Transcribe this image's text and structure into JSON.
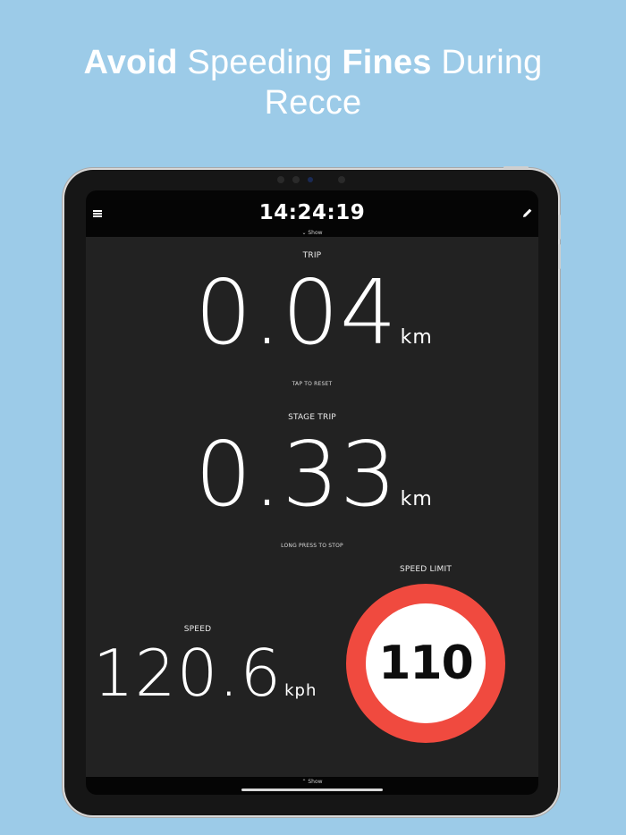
{
  "headline": {
    "part1_bold": "Avoid",
    "part2": " Speeding ",
    "part3_bold": "Fines",
    "part4": " During",
    "line2": "Recce"
  },
  "app": {
    "clock": "14:24:19",
    "show_top": "⌄ Show",
    "show_bottom": "⌃ Show",
    "trip": {
      "label": "TRIP",
      "value": "0.04",
      "unit": "km",
      "hint": "TAP TO RESET"
    },
    "stage_trip": {
      "label": "STAGE TRIP",
      "value": "0.33",
      "unit": "km",
      "hint": "LONG PRESS TO STOP"
    },
    "speed": {
      "label": "SPEED",
      "value": "120.6",
      "unit": "kph"
    },
    "speed_limit": {
      "label": "SPEED LIMIT",
      "value": "110"
    }
  },
  "colors": {
    "background": "#9ccbe8",
    "sign_ring": "#f04a3f"
  },
  "icons": {
    "menu": "menu-icon",
    "edit": "pencil-icon"
  }
}
